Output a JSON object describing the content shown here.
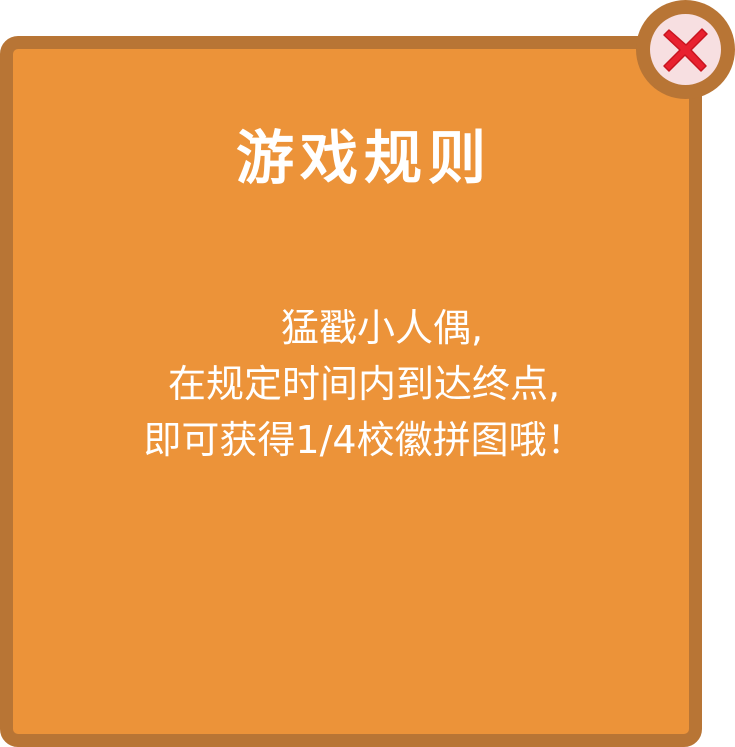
{
  "dialog": {
    "title": "游戏规则",
    "rules_lines": [
      "猛戳小人偶,",
      "在规定时间内到达终点,",
      "即可获得1/4校徽拼图哦！"
    ]
  },
  "close_button": {
    "icon": "close-icon"
  },
  "colors": {
    "panel_fill": "#ec9339",
    "panel_border": "#b87535",
    "close_circle": "#f7dfe1",
    "close_x": "#e8212f",
    "text": "#ffffff"
  }
}
